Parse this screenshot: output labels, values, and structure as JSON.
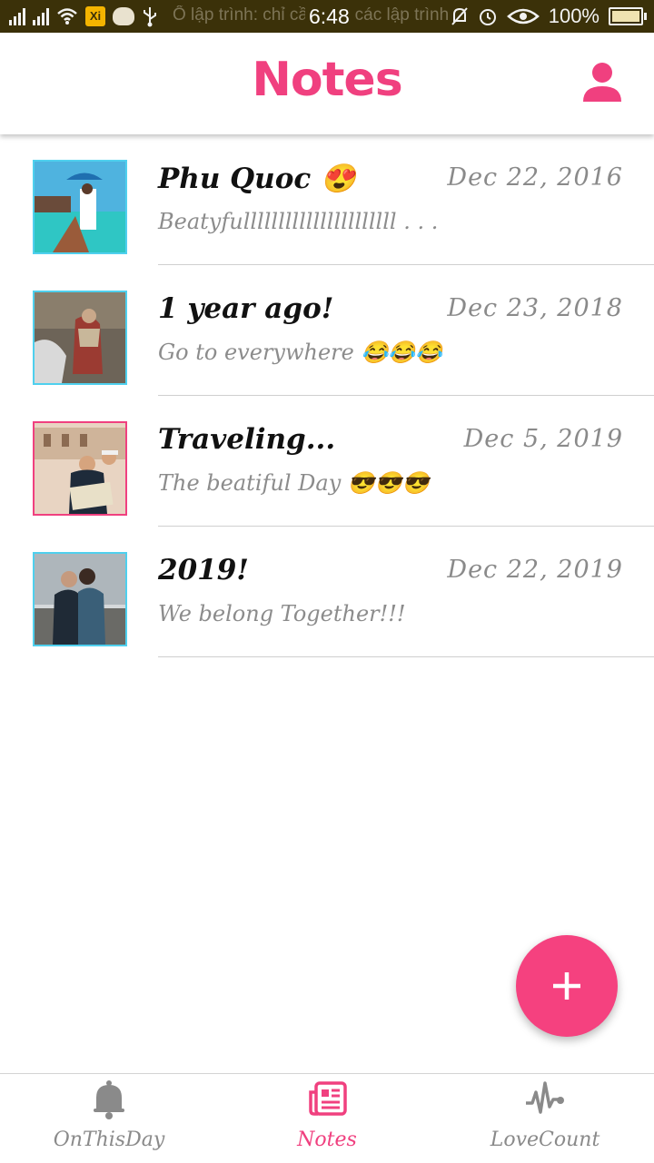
{
  "status_bar": {
    "ticker_text": "Ổ lập trình: chỉ cần cho các lập trình",
    "time": "6:48",
    "battery": "100%"
  },
  "header": {
    "title": "Notes",
    "profile_icon": "person-icon"
  },
  "notes": [
    {
      "title": "Phu Quoc 😍",
      "subtitle": "Beatyfullllllllllllllllllllll . . .",
      "date": "Dec 22, 2016",
      "thumb_border": "#4fd0ee"
    },
    {
      "title": "1 year ago!",
      "subtitle": "Go to everywhere 😂😂😂",
      "date": "Dec 23, 2018",
      "thumb_border": "#4fd0ee"
    },
    {
      "title": "Traveling...",
      "subtitle": "The beatiful Day 😎😎😎",
      "date": "Dec 5, 2019",
      "thumb_border": "#f0407f"
    },
    {
      "title": "2019!",
      "subtitle": "We belong Together!!!",
      "date": "Dec 22, 2019",
      "thumb_border": "#4fd0ee"
    }
  ],
  "fab": {
    "icon": "plus-icon",
    "label": "+"
  },
  "bottom_nav": {
    "items": [
      {
        "label": "OnThisDay",
        "icon": "bell-icon",
        "active": false
      },
      {
        "label": "Notes",
        "icon": "newspaper-icon",
        "active": true
      },
      {
        "label": "LoveCount",
        "icon": "heartbeat-icon",
        "active": false
      }
    ]
  },
  "colors": {
    "accent": "#f0407f",
    "status_bar": "#3b3109",
    "thumb_border": "#4fd0ee"
  }
}
